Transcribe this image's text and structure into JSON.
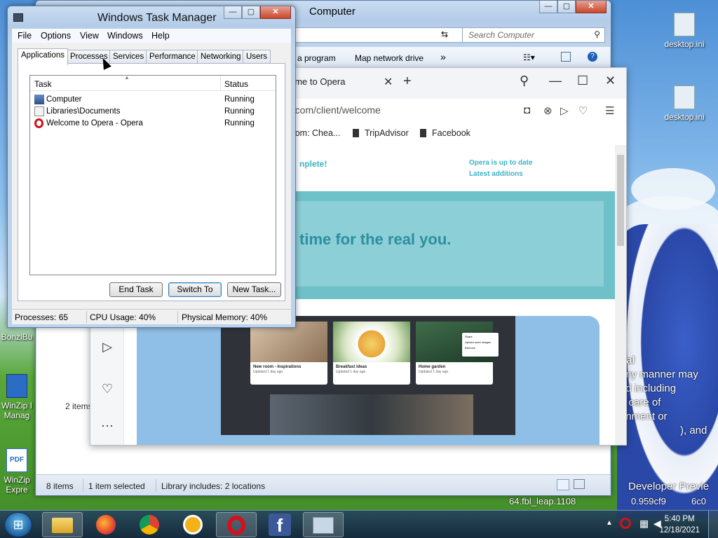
{
  "desktop": {
    "icons": [
      {
        "label": "desktop.ini"
      },
      {
        "label": "desktop.ini"
      },
      {
        "label": "BonziBu"
      },
      {
        "label": "WinZip I Manag"
      },
      {
        "label": "WinZip Expre"
      }
    ],
    "wallpaper_text": [
      "tial",
      "any manner may",
      "nd including",
      "e care of",
      "gnment or",
      "), and",
      "Developer Previe",
      "64.fbl_leap.1108",
      "0.959cf9",
      "6c0"
    ]
  },
  "explorer": {
    "title": "Computer",
    "search_placeholder": "Search Computer",
    "toolbar": {
      "uninstall_frag": "a program",
      "map_drive": "Map network drive",
      "more": "»"
    },
    "items_frag": "2 items",
    "status": {
      "items": "8 items",
      "selected": "1 item selected",
      "library": "Library includes: 2 locations"
    }
  },
  "opera": {
    "tab_title": "ome to Opera",
    "url": "a.com/client/welcome",
    "bookmarks": [
      {
        "label": ".com: Chea..."
      },
      {
        "label": "TripAdvisor"
      },
      {
        "label": "Facebook"
      }
    ],
    "page": {
      "headline": "nplete!",
      "links": [
        "Opera is up to date",
        "Latest additions"
      ],
      "banner": "time for the real you.",
      "cards": [
        {
          "title": "New room - Inspirations",
          "sub": "Updated 1 day ago"
        },
        {
          "title": "Breakfast ideas",
          "sub": "Updated 1 day ago"
        },
        {
          "title": "Home garden",
          "sub": "Updated 1 day ago"
        }
      ],
      "context_menu": [
        "Share",
        "Upload more images",
        "Remove"
      ]
    }
  },
  "taskmgr": {
    "title": "Windows Task Manager",
    "menu": [
      "File",
      "Options",
      "View",
      "Windows",
      "Help"
    ],
    "tabs": [
      "Applications",
      "Processes",
      "Services",
      "Performance",
      "Networking",
      "Users"
    ],
    "columns": {
      "task": "Task",
      "status": "Status"
    },
    "rows": [
      {
        "task": "Computer",
        "status": "Running"
      },
      {
        "task": "Libraries\\Documents",
        "status": "Running"
      },
      {
        "task": "Welcome to Opera - Opera",
        "status": "Running"
      }
    ],
    "buttons": {
      "end_task": "End Task",
      "switch_to": "Switch To",
      "new_task": "New Task..."
    },
    "status": {
      "processes": "Processes: 65",
      "cpu": "CPU Usage: 40%",
      "memory": "Physical Memory: 40%"
    }
  },
  "taskbar": {
    "apps": [
      "explorer",
      "firefox",
      "chrome",
      "security-lock",
      "opera",
      "facebook",
      "task-manager"
    ],
    "clock": {
      "time": "5:40 PM",
      "date": "12/18/2021"
    }
  }
}
